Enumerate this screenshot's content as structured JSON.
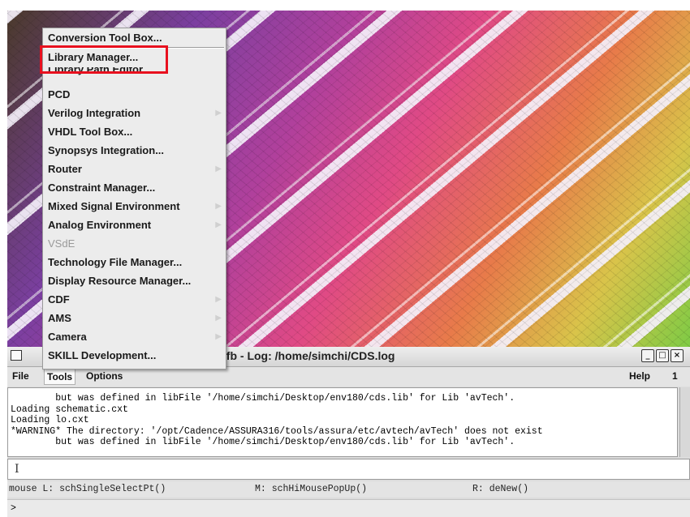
{
  "ciw": {
    "title": "cfb - Log: /home/simchi/CDS.log",
    "menus": [
      "File",
      "Tools",
      "Options"
    ],
    "help": "Help",
    "corner": "1",
    "log_lines": [
      "        but was defined in libFile '/home/simchi/Desktop/env180/cds.lib' for Lib 'avTech'.",
      "Loading schematic.cxt",
      "Loading lo.cxt",
      "*WARNING* The directory: '/opt/Cadence/ASSURA316/tools/assura/etc/avtech/avTech' does not exist",
      "        but was defined in libFile '/home/simchi/Desktop/env180/cds.lib' for Lib 'avTech'."
    ],
    "input_cursor": "I",
    "mouse": {
      "left": "mouse L: schSingleSelectPt()",
      "middle": "M: schHiMousePopUp()",
      "right": "R: deNew()"
    },
    "prompt": ">"
  },
  "tools_menu": {
    "items": [
      {
        "label": "Conversion Tool Box...",
        "submenu": false,
        "enabled": true
      },
      {
        "label": "Library Manager...",
        "submenu": false,
        "enabled": true
      },
      {
        "label": "Library Path Editor...",
        "submenu": false,
        "enabled": true
      },
      {
        "label": "PCD",
        "submenu": false,
        "enabled": true
      },
      {
        "label": "Verilog Integration",
        "submenu": true,
        "enabled": true
      },
      {
        "label": "VHDL Tool Box...",
        "submenu": false,
        "enabled": true
      },
      {
        "label": "Synopsys Integration...",
        "submenu": false,
        "enabled": true
      },
      {
        "label": "Router",
        "submenu": true,
        "enabled": true
      },
      {
        "label": "Constraint Manager...",
        "submenu": false,
        "enabled": true
      },
      {
        "label": "Mixed Signal Environment",
        "submenu": true,
        "enabled": true
      },
      {
        "label": "Analog Environment",
        "submenu": true,
        "enabled": true
      },
      {
        "label": "VSdE",
        "submenu": false,
        "enabled": false
      },
      {
        "label": "Technology File Manager...",
        "submenu": false,
        "enabled": true
      },
      {
        "label": "Display Resource Manager...",
        "submenu": false,
        "enabled": true
      },
      {
        "label": "CDF",
        "submenu": true,
        "enabled": true
      },
      {
        "label": "AMS",
        "submenu": true,
        "enabled": true
      },
      {
        "label": "Camera",
        "submenu": true,
        "enabled": true
      },
      {
        "label": "SKILL Development...",
        "submenu": false,
        "enabled": true
      }
    ],
    "highlighted": "Library Manager...",
    "highlight_color": "#e8101e"
  }
}
